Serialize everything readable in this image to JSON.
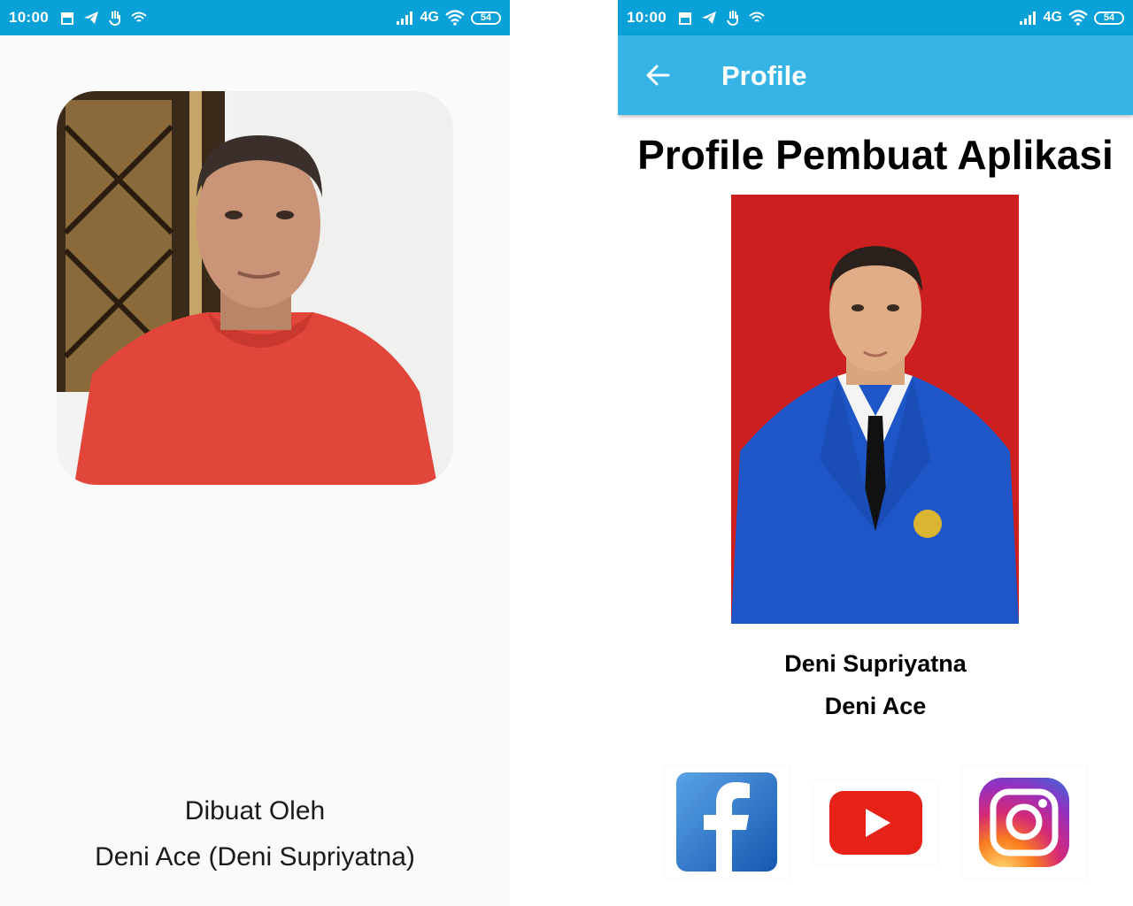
{
  "status_bar": {
    "time": "10:00",
    "network": "4G",
    "battery": "54",
    "icons": [
      "store-icon",
      "telegram-icon",
      "hand-icon",
      "wifi-small-icon",
      "signal-icon",
      "wifi-icon",
      "battery-icon"
    ]
  },
  "splash_screen": {
    "credit_line1": "Dibuat Oleh",
    "credit_line2": "Deni Ace (Deni Supriyatna)"
  },
  "profile_screen": {
    "appbar_title": "Profile",
    "heading": "Profile Pembuat Aplikasi",
    "full_name": "Deni Supriyatna",
    "nickname": "Deni Ace",
    "social_icons": [
      "facebook-icon",
      "youtube-icon",
      "instagram-icon"
    ]
  },
  "colors": {
    "status_bar": "#0aa0d8",
    "app_bar": "#36b4e6",
    "facebook": "#1877f2",
    "youtube": "#e62117",
    "instagram_gradient": [
      "#feda75",
      "#fa7e1e",
      "#d62976",
      "#962fbf",
      "#4f5bd5"
    ]
  }
}
